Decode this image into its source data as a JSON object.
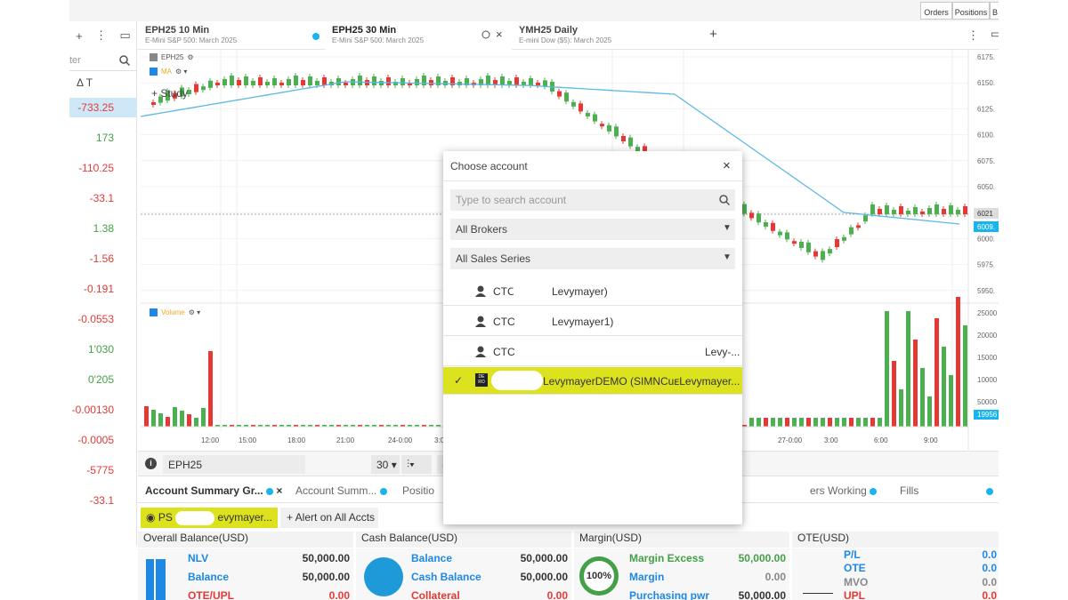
{
  "topbar": {
    "orders": "Orders",
    "positions": "Positions",
    "b": "B"
  },
  "left_column": {
    "plus": "+",
    "more": "⋮",
    "panel": "▭",
    "search_placeholder": "ter",
    "delta_header": "Δ T",
    "values": [
      "-733.25",
      "173",
      "-110.25",
      "-33.1",
      "1.38",
      "-1.56",
      "-0.191",
      "-0.0553",
      "1'030",
      "0'205",
      "-0.00130",
      "-0.0005",
      "-5775",
      "-33.1"
    ]
  },
  "chart_tabs": [
    {
      "title": "EPH25 10 Min",
      "subtitle": "E-Mini S&P 500: March 2025"
    },
    {
      "title": "EPH25 30 Min",
      "subtitle": "E-Mini S&P 500: March 2025"
    },
    {
      "title": "YMH25 Daily",
      "subtitle": "E-mini Dow ($5): March 2025"
    }
  ],
  "chart": {
    "legend": {
      "symbol": "EPH25",
      "ma": "MA",
      "study": "+ Study",
      "volume": "Volume"
    },
    "price_ticks": [
      "6175.",
      "6150.",
      "6125.",
      "6100.",
      "6075.",
      "6050.",
      "6025.",
      "6000.",
      "5975.",
      "5950."
    ],
    "current_price": "6021",
    "ma_value": "6009.",
    "volume_ticks": [
      "25000",
      "20000",
      "15000",
      "10000",
      "50000"
    ],
    "volume_last": "19956",
    "time_labels": [
      "12:00",
      "15:00",
      "18:00",
      "21:00",
      "24-0:00",
      "3:0",
      "27-0:00",
      "3:00",
      "6:00",
      "9:00"
    ],
    "colors": {
      "up": "#4caf50",
      "down": "#e53935",
      "ma": "#5bb8e6",
      "accent": "#19b3f0"
    }
  },
  "toolbar": {
    "symbol": "EPH25",
    "interval": "30"
  },
  "bottom_tabs": [
    {
      "label": "Account Summary Gr..."
    },
    {
      "label": "Account Summ..."
    },
    {
      "label": "Positio"
    },
    {
      "label": "ers Working"
    },
    {
      "label": "Fills"
    }
  ],
  "account_chip": {
    "left": "PS",
    "right": "evymayer..."
  },
  "alert_button": "+ Alert on All Accts",
  "sections": {
    "overall": {
      "title": "Overall Balance(USD)",
      "rows": [
        {
          "label": "NLV",
          "value": "50,000.00"
        },
        {
          "label": "Balance",
          "value": "50,000.00"
        },
        {
          "label": "OTE/UPL",
          "value": "0.00"
        }
      ]
    },
    "cash": {
      "title": "Cash Balance(USD)",
      "rows": [
        {
          "label": "Balance",
          "value": "50,000.00"
        },
        {
          "label": "Cash Balance",
          "value": "50,000.00"
        },
        {
          "label": "Collateral",
          "value": "0.00"
        }
      ]
    },
    "margin": {
      "title": "Margin(USD)",
      "gauge": "100%",
      "rows": [
        {
          "label": "Margin Excess",
          "value": "50,000.00"
        },
        {
          "label": "Margin",
          "value": "0.00"
        },
        {
          "label": "Purchasing pwr",
          "value": "50,000.00"
        }
      ]
    },
    "ote": {
      "title": "OTE(USD)",
      "rows": [
        {
          "label": "P/L",
          "value": "0.0"
        },
        {
          "label": "OTE",
          "value": "0.0"
        },
        {
          "label": "MVO",
          "value": "0.0"
        },
        {
          "label": "UPL",
          "value": "0.0"
        }
      ]
    }
  },
  "modal": {
    "title": "Choose account",
    "close": "×",
    "search_placeholder": "Type to search account",
    "brokers": "All Brokers",
    "sales": "All Sales Series",
    "items": [
      {
        "left": "CTC",
        "right": "Levymayer)",
        "extra": ""
      },
      {
        "left": "CTC'",
        "right": "Levymayer1)",
        "extra": ""
      },
      {
        "left": "CTC",
        "right": "",
        "extra": "Levy-..."
      },
      {
        "left": "",
        "right": "LevymayerDEMO (SIMN",
        "extra": "CuᴇLevymayer..."
      }
    ],
    "demo_badge": "DE\nRO"
  }
}
